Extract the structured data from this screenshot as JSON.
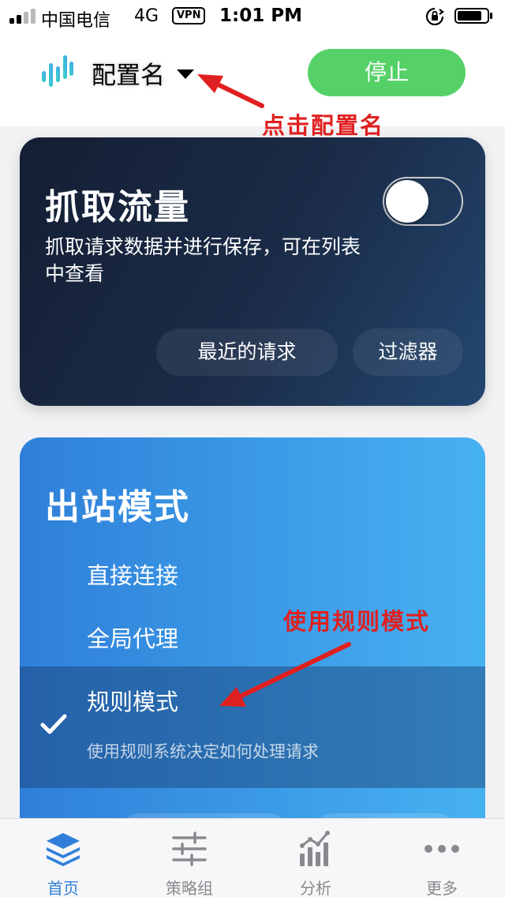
{
  "status_bar": {
    "carrier": "中国电信",
    "network": "4G",
    "vpn": "VPN",
    "time": "1:01 PM"
  },
  "header": {
    "profile_name": "配置名",
    "stop_label": "停止",
    "annotation": "点击配置名",
    "stop_color": "#55d168"
  },
  "capture": {
    "title": "抓取流量",
    "description": "抓取请求数据并进行保存，可在列表中查看",
    "toggle_on": false,
    "recent_requests_label": "最近的请求",
    "filter_label": "过滤器"
  },
  "outbound": {
    "title": "出站模式",
    "modes": [
      {
        "label": "直接连接",
        "selected": false
      },
      {
        "label": "全局代理",
        "selected": false
      },
      {
        "label": "规则模式",
        "selected": true,
        "description": "使用规则系统决定如何处理请求"
      }
    ],
    "annotation": "使用规则模式"
  },
  "tab_bar": {
    "tabs": [
      {
        "label": "首页",
        "icon": "layers-icon",
        "active": true
      },
      {
        "label": "策略组",
        "icon": "sliders-icon",
        "active": false
      },
      {
        "label": "分析",
        "icon": "bar-chart-icon",
        "active": false
      },
      {
        "label": "更多",
        "icon": "more-dots-icon",
        "active": false
      }
    ],
    "active_color": "#2f7fd9"
  },
  "colors": {
    "annotation_red": "#e02020",
    "capture_card_dark": "#141e33",
    "outbound_card_blue": "#3d9ee8"
  }
}
